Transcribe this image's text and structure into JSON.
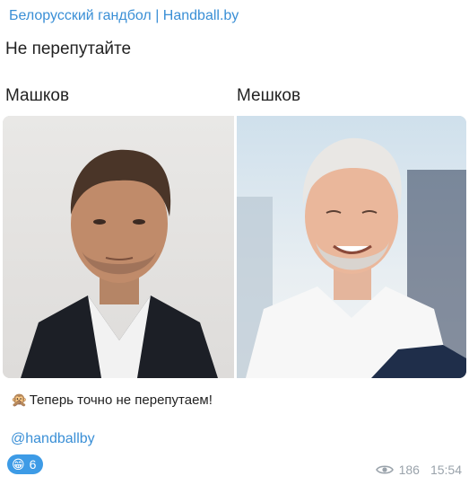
{
  "post": {
    "channel_name": "Белорусский гандбол | Handball.by",
    "headline": "Не перепутайте",
    "caption_left": "Машков",
    "caption_right": "Мешков",
    "message_emoji": "🙊",
    "message_text": "Теперь точно не перепутаем!",
    "hashtag": "@handballby",
    "reaction": {
      "emoji": "😁",
      "count": "6"
    },
    "views": "186",
    "time": "15:54"
  },
  "colors": {
    "link": "#3a8fd6",
    "reaction_bg": "#3d9be6",
    "meta_text": "#9aa3ab"
  },
  "icons": {
    "views": "eye-icon",
    "message": "speak-no-evil-monkey",
    "reaction": "grinning-face"
  }
}
